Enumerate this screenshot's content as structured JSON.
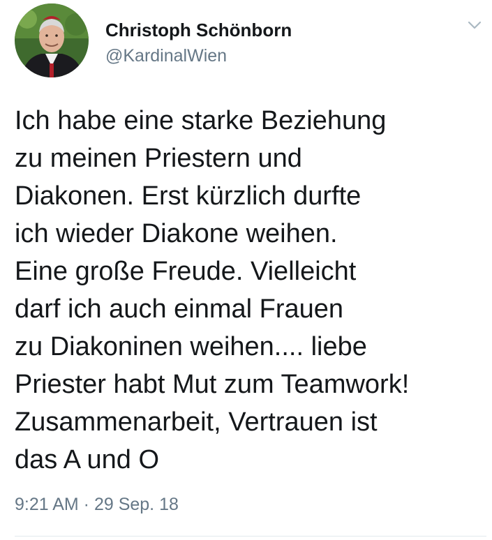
{
  "author": {
    "display_name": "Christoph Schönborn",
    "handle": "@KardinalWien",
    "avatar_icon": "user-avatar"
  },
  "menu": {
    "icon": "chevron-down-icon"
  },
  "tweet": {
    "lines": [
      "Ich habe eine starke Beziehung",
      "zu meinen Priestern und",
      "Diakonen. Erst kürzlich durfte",
      "ich wieder Diakone weihen.",
      "Eine große Freude. Vielleicht",
      "darf ich auch einmal Frauen",
      "zu Diakoninen weihen.... liebe",
      "Priester habt Mut zum Teamwork!",
      "Zusammenarbeit, Vertrauen ist",
      "das A und O"
    ],
    "timestamp": "9:21 AM · 29 Sep. 18"
  },
  "colors": {
    "text": "#14171a",
    "secondary": "#657786",
    "divider": "#e1e8ed"
  }
}
